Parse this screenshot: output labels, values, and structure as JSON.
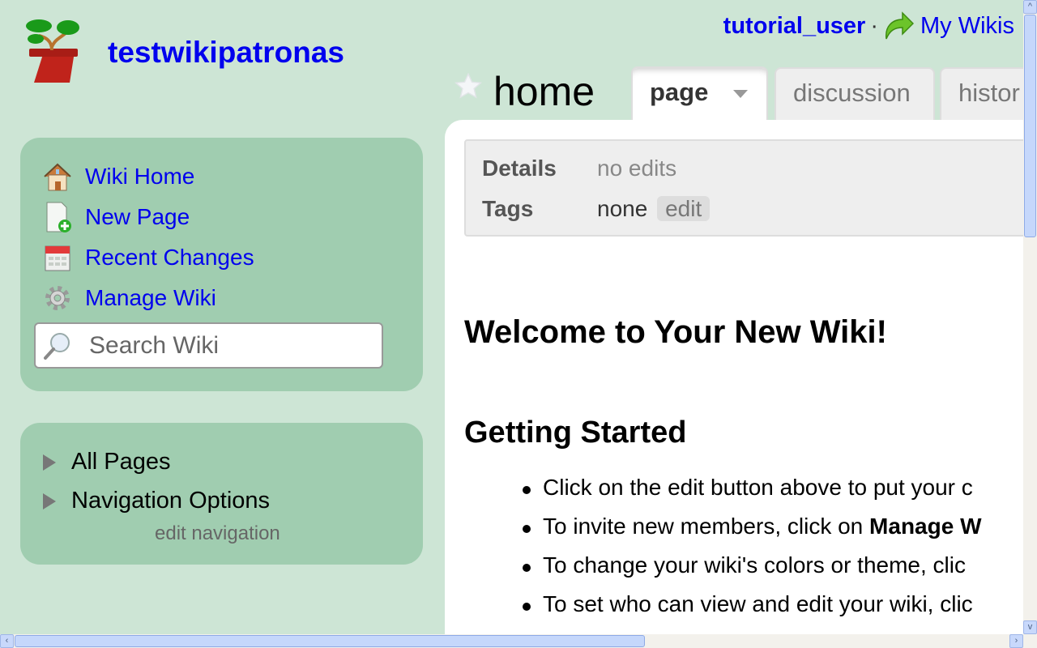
{
  "site": {
    "title": "testwikipatronas",
    "logo": "bonsai-pot-logo"
  },
  "userbar": {
    "username": "tutorial_user",
    "separator": "·",
    "my_wikis": "My Wikis",
    "my_wikis_icon": "green-arrow-icon"
  },
  "page": {
    "title": "home",
    "favorite_icon": "star-icon"
  },
  "tabs": [
    {
      "label": "page",
      "active": true
    },
    {
      "label": "discussion"
    },
    {
      "label": "histor"
    }
  ],
  "details": {
    "details_label": "Details",
    "details_value": "no edits",
    "tags_label": "Tags",
    "tags_value": "none",
    "tags_edit": "edit"
  },
  "content": {
    "heading": "Welcome to Your New Wiki!",
    "subheading": "Getting Started",
    "bullets": [
      {
        "text": "Click on the edit button above to put your c"
      },
      {
        "text": "To invite new members, click on ",
        "bold": "Manage W"
      },
      {
        "text": "To change your wiki's colors or theme, clic"
      },
      {
        "text": "To set who can view and edit your wiki, clic"
      }
    ]
  },
  "sidebar": {
    "items": [
      {
        "label": "Wiki Home",
        "icon": "house-icon"
      },
      {
        "label": "New Page",
        "icon": "new-page-icon"
      },
      {
        "label": "Recent Changes",
        "icon": "calendar-icon"
      },
      {
        "label": "Manage Wiki",
        "icon": "gear-icon"
      }
    ],
    "search_placeholder": "Search Wiki",
    "tree": [
      {
        "label": "All Pages"
      },
      {
        "label": "Navigation Options"
      }
    ],
    "edit_navigation": "edit navigation"
  },
  "colors": {
    "background": "#cde5d5",
    "sidebar_box": "#a0cdb0",
    "link": "#0000ee"
  },
  "scroll": {
    "vertical_fraction_visible": 0.36,
    "horizontal_fraction_visible": 0.62
  }
}
